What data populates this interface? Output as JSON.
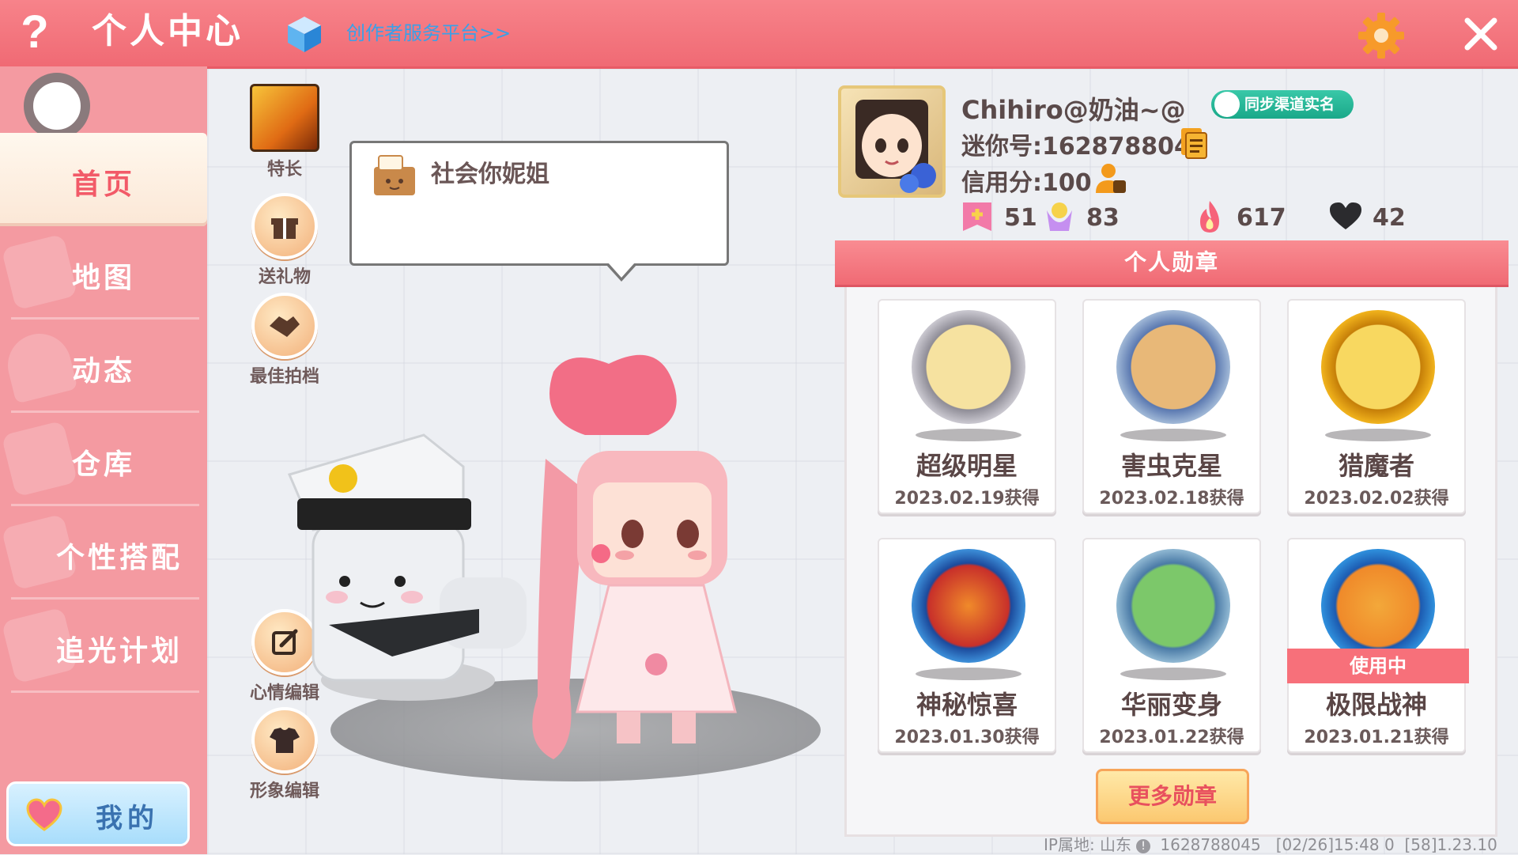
{
  "header": {
    "title": "个人中心",
    "creator_link": "创作者服务平台>>"
  },
  "sidebar": {
    "items": [
      {
        "label": "首页"
      },
      {
        "label": "地图"
      },
      {
        "label": "动态"
      },
      {
        "label": "仓库"
      },
      {
        "label": "个性搭配"
      },
      {
        "label": "追光计划"
      }
    ],
    "mine_label": "我的"
  },
  "actions": {
    "skill": "特长",
    "gift": "送礼物",
    "best_photo": "最佳拍档",
    "mood_edit": "心情编辑",
    "look_edit": "形象编辑"
  },
  "bubble": {
    "text": "社会你妮姐"
  },
  "profile": {
    "name": "Chihiro@奶油~@",
    "sync_label": "同步渠道实名",
    "mini_id": "迷你号:1628788045",
    "credit": "信用分:100",
    "stats": {
      "plus": "51",
      "trophy": "83",
      "fire": "617",
      "heart": "42"
    }
  },
  "medals": {
    "header": "个人勋章",
    "items": [
      {
        "name": "超级明星",
        "date": "2023.02.19获得",
        "color": "#c9c7cf"
      },
      {
        "name": "害虫克星",
        "date": "2023.02.18获得",
        "color": "#9fb7d6"
      },
      {
        "name": "猎魔者",
        "date": "2023.02.02获得",
        "color": "#f0b21c"
      },
      {
        "name": "神秘惊喜",
        "date": "2023.01.30获得",
        "color": "#3c8ed8"
      },
      {
        "name": "华丽变身",
        "date": "2023.01.22获得",
        "color": "#8fb7d2"
      },
      {
        "name": "极限战神",
        "date": "2023.01.21获得",
        "color": "#2f8fdc",
        "in_use": "使用中"
      }
    ],
    "more_label": "更多勋章"
  },
  "footer": {
    "ip_label": "IP属地: 山东",
    "id": "1628788045",
    "time": "[02/26]15:48 0",
    "build": "[58]1.23.10"
  },
  "colors": {
    "accent": "#f06a74",
    "sidebar": "#f49aa1"
  }
}
